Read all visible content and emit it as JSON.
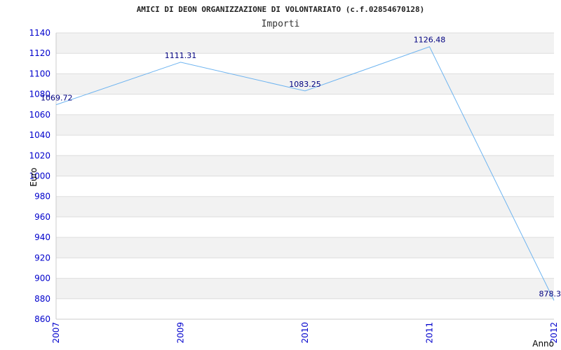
{
  "chart_data": {
    "type": "line",
    "title": "AMICI DI DEON ORGANIZZAZIONE DI VOLONTARIATO (c.f.02854670128)",
    "subtitle": "Importi",
    "xlabel": "Anno",
    "ylabel": "Euro",
    "x": [
      "2007",
      "2009",
      "2010",
      "2011",
      "2012"
    ],
    "values": [
      1069.72,
      1111.31,
      1083.25,
      1126.48,
      878.3
    ],
    "data_labels": [
      "1069.72",
      "1111.31",
      "1083.25",
      "1126.48",
      "878.3"
    ],
    "ylim": [
      860,
      1140
    ],
    "yticks": [
      1140,
      1120,
      1100,
      1080,
      1060,
      1040,
      1020,
      1000,
      980,
      960,
      940,
      920,
      900,
      880,
      860
    ],
    "grid": true,
    "line_color": "#6eb4f0",
    "band_color": "#f2f2f2",
    "gridline_color": "#dddddd"
  }
}
